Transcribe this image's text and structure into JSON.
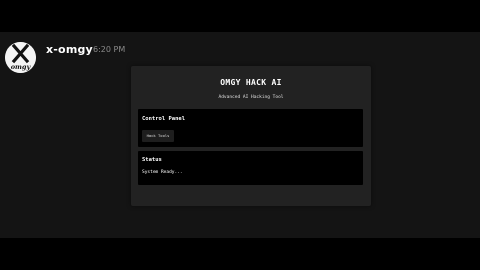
{
  "message": {
    "username": "x-omgy",
    "timestamp": "6:20 PM",
    "avatar_text": "omgy"
  },
  "app": {
    "title": "OMGY HACK AI",
    "subtitle": "Advanced AI Hacking Tool",
    "control_panel": {
      "heading": "Control Panel",
      "button_label": "Hack Tools"
    },
    "status_panel": {
      "heading": "Status",
      "status_text": "System Ready..."
    }
  },
  "colors": {
    "page_background": "#000000",
    "chat_background": "#141414",
    "app_background": "#222222",
    "panel_background": "#000000",
    "button_background": "#1e1e1e"
  }
}
